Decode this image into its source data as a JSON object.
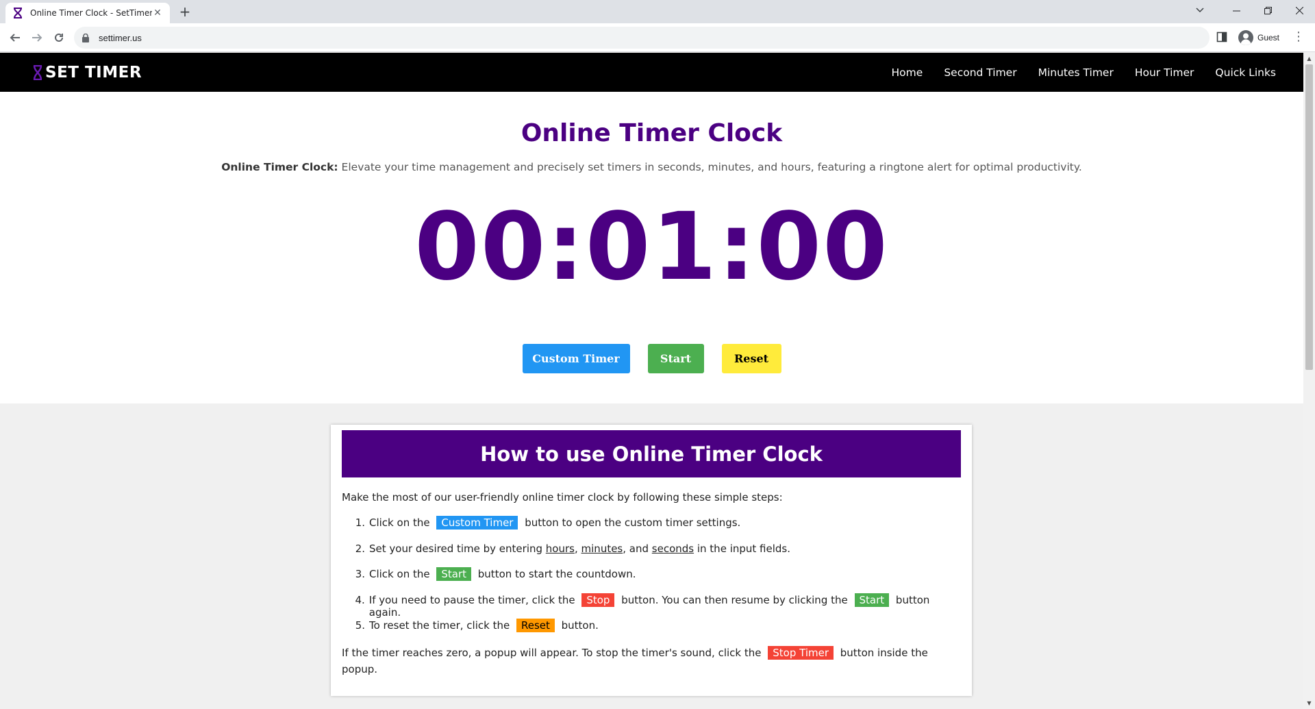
{
  "browser": {
    "tab_title": "Online Timer Clock - SetTimer.us",
    "url": "settimer.us",
    "profile_label": "Guest",
    "new_tab_label": "+",
    "close_label": "✕"
  },
  "site": {
    "logo_text": "SET TIMER",
    "nav": [
      {
        "label": "Home"
      },
      {
        "label": "Second Timer"
      },
      {
        "label": "Minutes Timer"
      },
      {
        "label": "Hour Timer"
      },
      {
        "label": "Quick Links"
      }
    ]
  },
  "hero": {
    "title": "Online Timer Clock",
    "intro_strong": "Online Timer Clock:",
    "intro_text": " Elevate your time management and precisely set timers in seconds, minutes, and hours, featuring a ringtone alert for optimal productivity.",
    "timer": "00:01:00",
    "buttons": {
      "custom": "Custom Timer",
      "start": "Start",
      "reset": "Reset"
    }
  },
  "howto": {
    "title": "How to use Online Timer Clock",
    "lead": "Make the most of our user-friendly online timer clock by following these simple steps:",
    "steps": [
      {
        "num": "1.",
        "pre": "Click on the ",
        "tag": "Custom Timer",
        "post": " button to open the custom timer settings."
      },
      {
        "num": "2.",
        "pre": "Set your desired time by entering ",
        "u1": "hours",
        "sep1": ", ",
        "u2": "minutes",
        "sep2": ", and ",
        "u3": "seconds",
        "post": " in the input fields."
      },
      {
        "num": "3.",
        "pre": "Click on the ",
        "tag": "Start",
        "post": " button to start the countdown."
      },
      {
        "num": "4.",
        "pre": "If you need to pause the timer, click the ",
        "tag": "Stop",
        "mid": " button. You can then resume by clicking the ",
        "tag2": "Start",
        "post": " button again."
      },
      {
        "num": "5.",
        "pre": "To reset the timer, click the ",
        "tag": "Reset",
        "post": " button."
      }
    ],
    "note_pre": "If the timer reaches zero, a popup will appear. To stop the timer's sound, click the ",
    "note_tag": "Stop Timer",
    "note_post": " button inside the popup."
  },
  "colors": {
    "brand_purple": "#4b0082",
    "blue": "#2196f3",
    "green": "#4caf50",
    "yellow": "#ffeb3b",
    "red": "#f44336",
    "orange": "#ff9800"
  }
}
